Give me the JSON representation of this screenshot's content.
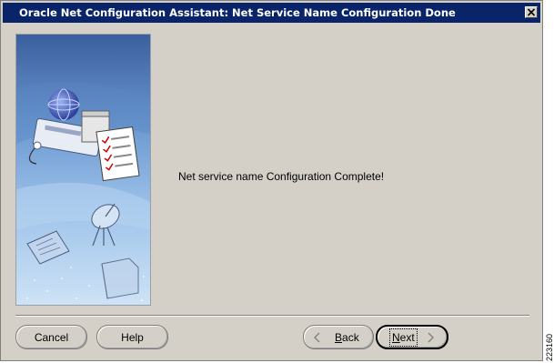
{
  "window": {
    "title": "Oracle Net Configuration Assistant: Net Service Name Configuration Done"
  },
  "main": {
    "message": "Net service name Configuration Complete!"
  },
  "buttons": {
    "cancel": "Cancel",
    "help": "Help",
    "back_mnemonic": "B",
    "back_rest": "ack",
    "next_mnemonic": "N",
    "next_rest": "ext"
  },
  "side_code": "223160",
  "icons": {
    "close": "close-icon",
    "back": "chevron-left-icon",
    "next": "chevron-right-icon"
  },
  "colors": {
    "titlebar": "#0a246a",
    "dialog_bg": "#d4d0c8"
  }
}
